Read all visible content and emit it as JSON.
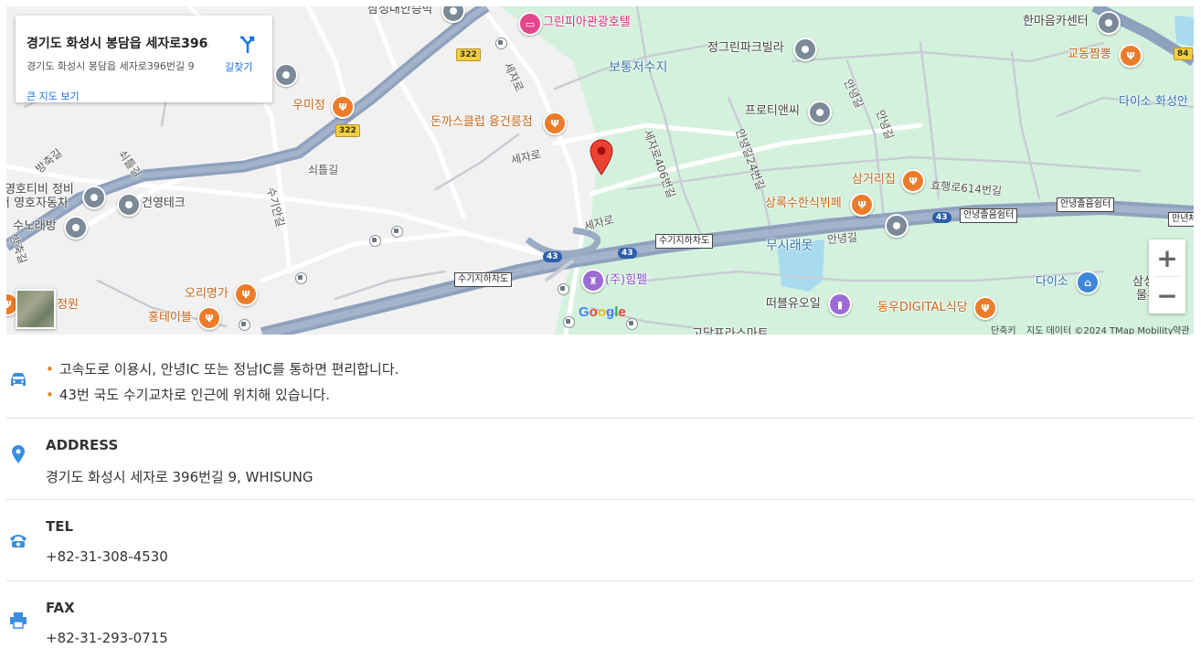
{
  "map": {
    "card": {
      "title": "경기도 화성시 봉담읍 세자로396...",
      "address": "경기도 화성시 봉담읍 세자로396번길 9",
      "directions": "길찾기",
      "big_map": "큰 지도 보기"
    },
    "labels": {
      "samsung_top": "삼성내안승박",
      "greenpia": "그린피아관광호텔",
      "hanmaeum": "한마음카센터",
      "jeonggreen": "정그린파크빌라",
      "gyodong": "교동짬뽕",
      "botong": "보통저수지",
      "daiso_hw": "다이소 화성안",
      "umijeong": "우미정",
      "donkas": "돈까스클럽 융건릉점",
      "protien": "프로티앤씨",
      "banjuk": "방축길",
      "soeteul1": "쇠틀길",
      "soeteul2": "쇠틀길",
      "sejaro1": "세자로",
      "sejaro2": "세자로",
      "sejaro3": "세자로",
      "sejaro406": "세자로406번길",
      "annyeong24": "안녕길24번길",
      "annyeong1": "안녕길",
      "annyeong2": "안녕길",
      "annyeong3": "안녕길",
      "samgeori": "삼거리집",
      "hyohaeng": "효행로614번길",
      "sangrok": "상록수한식뷔페",
      "younghotv": "영호티비 정비",
      "youngho": "터 영호자동차",
      "geonyoung": "건영테크",
      "sunorae": "수노래방",
      "sugi": "수기안길",
      "banjuk2": "방축길",
      "musirae": "무시래못",
      "ori": "오리명가",
      "hongte": "홍테이블",
      "jeongwon": "정원",
      "himpel": "(주)힘펠",
      "tteobl": "떠블유오일",
      "dongwoo": "동우DIGITAL식당",
      "daiso": "다이소",
      "samsung_r": "삼성화",
      "mul": "물류T",
      "godam": "고담프라스마트"
    },
    "exits": {
      "sugi1": "수기지하차도",
      "sugi2": "수기지하차도",
      "annyeong1": "안녕졸음쉼터",
      "annyeong2": "안녕졸음쉼터",
      "minyeon": "만년체"
    },
    "shields": {
      "r322a": "322",
      "r322b": "322",
      "r84": "84",
      "r43a": "43",
      "r43b": "43",
      "r43c": "43"
    },
    "google_logo": "Google",
    "attribution": {
      "shortcuts": "단축키",
      "data": "지도 데이터 ©2024 TMap Mobility",
      "terms": "약관"
    },
    "zoom": {
      "in": "+",
      "out": "−"
    }
  },
  "info": {
    "directions": [
      "고속도로 이용시, 안녕IC 또는 정남IC를 통하면 편리합니다.",
      "43번 국도 수기교차로 인근에 위치해 있습니다."
    ],
    "address_label": "ADDRESS",
    "address_value": "경기도 화성시 세자로 396번길 9, WHISUNG",
    "tel_label": "TEL",
    "tel_value": "+82-31-308-4530",
    "fax_label": "FAX",
    "fax_value": "+82-31-293-0715"
  },
  "colors": {
    "icon_blue": "#3a8ee0",
    "bullet_orange": "#e67e22",
    "map_green": "#cdeedb",
    "highway": "#8ea1bd"
  }
}
